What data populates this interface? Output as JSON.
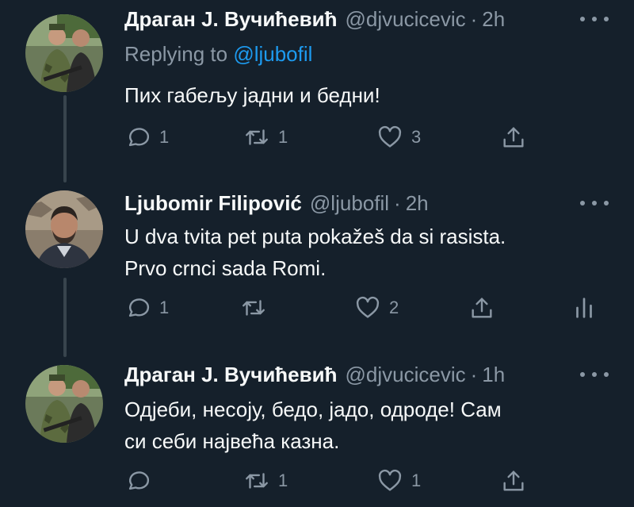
{
  "tweets": [
    {
      "name": "Драган Ј. Вучићевић",
      "handle": "@djvucicevic",
      "separator": "·",
      "time": "2h",
      "replying_prefix": "Replying to ",
      "replying_mention": "@ljubofil",
      "text": "Пих габељу јадни и бедни!",
      "reply_count": "1",
      "retweet_count": "1",
      "like_count": "3",
      "share_icon": "share-icon"
    },
    {
      "name": "Ljubomir Filipović",
      "handle": "@ljubofil",
      "separator": "·",
      "time": "2h",
      "text_line1": "U dva tvita pet puta pokažeš da si rasista.",
      "text_line2": "Prvo crnci sada Romi.",
      "reply_count": "1",
      "retweet_count": "",
      "like_count": "2",
      "analytics_icon": "analytics-icon"
    },
    {
      "name": "Драган Ј. Вучићевић",
      "handle": "@djvucicevic",
      "separator": "·",
      "time": "1h",
      "text_line1": "Одјеби, несоју, бедо, јадо, одроде! Сам",
      "text_line2": "си себи највећа казна.",
      "reply_count": "",
      "retweet_count": "1",
      "like_count": "1"
    }
  ],
  "colors": {
    "background": "#15202b",
    "text": "#f7f9f9",
    "secondary": "#8b98a5",
    "accent": "#1d9bf0",
    "thread_line": "#38444d"
  }
}
